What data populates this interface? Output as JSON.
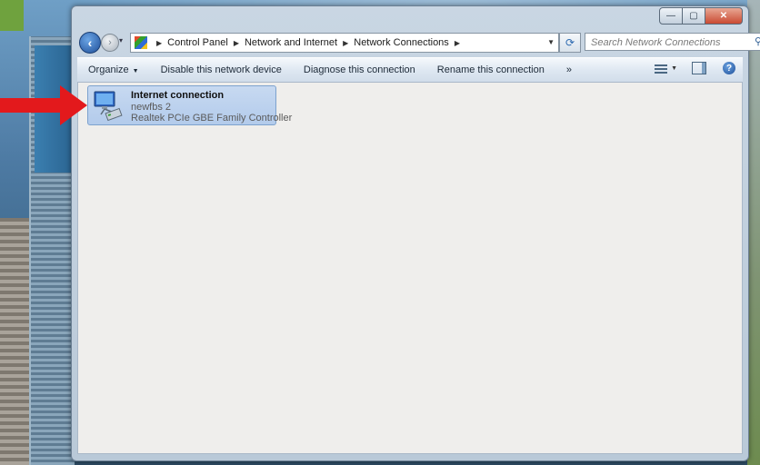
{
  "window": {
    "caption_buttons": {
      "minimize": "—",
      "maximize": "▢",
      "close": "✕"
    }
  },
  "navbar": {
    "back_icon": "back-arrow-icon",
    "forward_icon": "forward-arrow-icon",
    "breadcrumb": [
      "Control Panel",
      "Network and Internet",
      "Network Connections"
    ],
    "search_placeholder": "Search Network Connections"
  },
  "toolbar": {
    "organize": "Organize",
    "disable": "Disable this network device",
    "diagnose": "Diagnose this connection",
    "rename": "Rename this connection",
    "more": "»"
  },
  "connection": {
    "name": "Internet connection",
    "network": "newfbs  2",
    "device": "Realtek PCIe GBE Family Controller",
    "selected": true
  },
  "colors": {
    "selection_fill": "#c7d9f1",
    "selection_border": "#7da2ce",
    "annotation_arrow": "#e3191c"
  }
}
